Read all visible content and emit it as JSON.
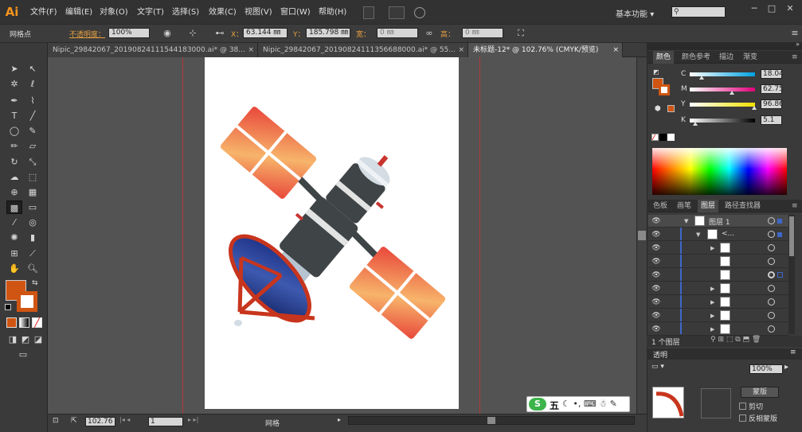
{
  "app": {
    "logo": "Ai"
  },
  "menu": [
    "文件(F)",
    "编辑(E)",
    "对象(O)",
    "文字(T)",
    "选择(S)",
    "效果(C)",
    "视图(V)",
    "窗口(W)",
    "帮助(H)"
  ],
  "workspace": "基本功能",
  "window_controls": [
    "─",
    "□",
    "✕"
  ],
  "control": {
    "selection_label": "网格点",
    "opacity_label": "不透明度：",
    "opacity_value": "100%",
    "x_label": "X：",
    "x_value": "63.144 ㎜",
    "y_label": "Y：",
    "y_value": "185.798 ㎜",
    "w_label": "宽：",
    "w_value": "0 ㎜",
    "h_label": "高：",
    "h_value": "0 ㎜"
  },
  "tabs": [
    {
      "label": "Nipic_29842067_20190824111544183000.ai* @ 38...",
      "close": "×"
    },
    {
      "label": "Nipic_29842067_20190824111356688000.ai* @ 55...",
      "close": "×"
    },
    {
      "label": "未标题-12* @ 102.76% (CMYK/预览)",
      "close": "×"
    }
  ],
  "status": {
    "zoom": "102.76",
    "page": "1",
    "tool_name": "网格"
  },
  "color_panel": {
    "tabs": [
      "颜色",
      "颜色参考",
      "描边",
      "渐变"
    ],
    "fill_color": "#d05512",
    "channels": [
      {
        "label": "C",
        "value": "18.04",
        "gradient": "linear-gradient(90deg,#fff,#00a0e0)"
      },
      {
        "label": "M",
        "value": "62.75",
        "gradient": "linear-gradient(90deg,#fff,#e0007a)"
      },
      {
        "label": "Y",
        "value": "96.86",
        "gradient": "linear-gradient(90deg,#fff,#f0e000)"
      },
      {
        "label": "K",
        "value": "5.1",
        "gradient": "linear-gradient(90deg,#fff,#000)"
      }
    ]
  },
  "layers_panel": {
    "tabs": [
      "色板",
      "画笔",
      "图层",
      "路径查找器"
    ],
    "layer_name": "图层 1",
    "group_name": "<...",
    "footer": "1 个图层"
  },
  "transparency_panel": {
    "header": "透明",
    "opacity": "100%",
    "mask_button": "蒙版",
    "clip_label": "剪切",
    "invert_label": "反相蒙版"
  },
  "ime": {
    "label": "五"
  },
  "colors": {
    "orange": "#d05512",
    "panel": "#3a3a3a",
    "artboard": "#ffffff"
  }
}
